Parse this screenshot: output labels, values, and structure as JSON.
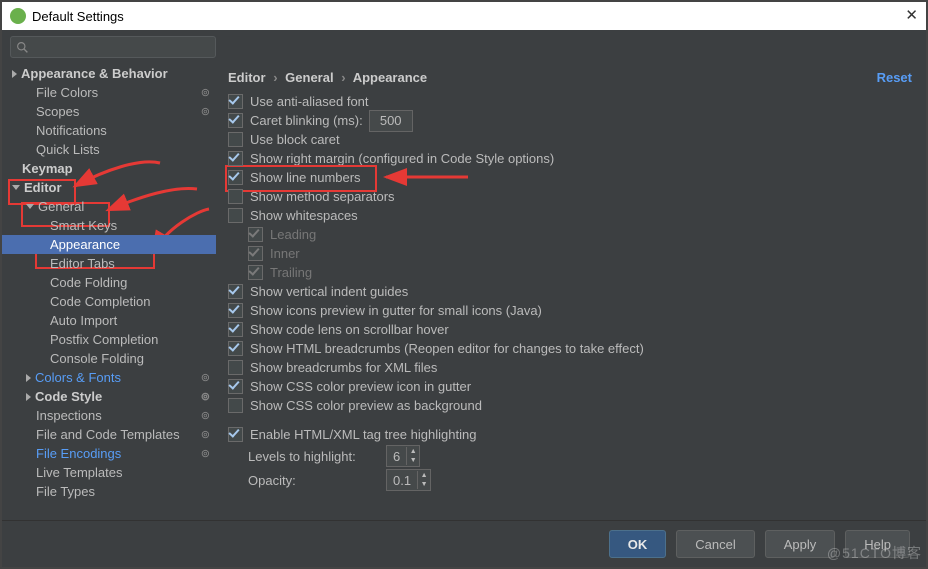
{
  "window": {
    "title": "Default Settings"
  },
  "sidebar": {
    "items": [
      {
        "label": "Appearance & Behavior",
        "indent": 10,
        "bold": true,
        "tri": "right"
      },
      {
        "label": "File Colors",
        "indent": 34,
        "gear": true
      },
      {
        "label": "Scopes",
        "indent": 34,
        "gear": true
      },
      {
        "label": "Notifications",
        "indent": 34
      },
      {
        "label": "Quick Lists",
        "indent": 34
      },
      {
        "label": "Keymap",
        "indent": 20,
        "bold": true
      },
      {
        "label": "Editor",
        "indent": 10,
        "bold": true,
        "tri": "down"
      },
      {
        "label": "General",
        "indent": 24,
        "tri": "down"
      },
      {
        "label": "Smart Keys",
        "indent": 48
      },
      {
        "label": "Appearance",
        "indent": 48,
        "sel": true
      },
      {
        "label": "Editor Tabs",
        "indent": 48
      },
      {
        "label": "Code Folding",
        "indent": 48
      },
      {
        "label": "Code Completion",
        "indent": 48
      },
      {
        "label": "Auto Import",
        "indent": 48
      },
      {
        "label": "Postfix Completion",
        "indent": 48
      },
      {
        "label": "Console Folding",
        "indent": 48
      },
      {
        "label": "Colors & Fonts",
        "indent": 24,
        "tri": "right",
        "link": true,
        "gear": true
      },
      {
        "label": "Code Style",
        "indent": 24,
        "bold": true,
        "tri": "right",
        "gear": true
      },
      {
        "label": "Inspections",
        "indent": 34,
        "gear": true
      },
      {
        "label": "File and Code Templates",
        "indent": 34,
        "gear": true
      },
      {
        "label": "File Encodings",
        "indent": 34,
        "link": true,
        "gear": true
      },
      {
        "label": "Live Templates",
        "indent": 34
      },
      {
        "label": "File Types",
        "indent": 34
      }
    ]
  },
  "breadcrumb": {
    "a": "Editor",
    "b": "General",
    "c": "Appearance",
    "reset": "Reset"
  },
  "options": [
    {
      "checked": true,
      "label": "Use anti-aliased font",
      "pad": 0
    },
    {
      "checked": true,
      "label": "Caret blinking (ms):",
      "pad": 0,
      "num": "500"
    },
    {
      "checked": false,
      "label": "Use block caret",
      "pad": 0
    },
    {
      "checked": true,
      "label": "Show right margin (configured in Code Style options)",
      "pad": 0
    },
    {
      "checked": true,
      "label": "Show line numbers",
      "pad": 0,
      "hl": true
    },
    {
      "checked": false,
      "label": "Show method separators",
      "pad": 0
    },
    {
      "checked": false,
      "label": "Show whitespaces",
      "pad": 0
    },
    {
      "checked": true,
      "label": "Leading",
      "pad": 20,
      "dis": true
    },
    {
      "checked": true,
      "label": "Inner",
      "pad": 20,
      "dis": true
    },
    {
      "checked": true,
      "label": "Trailing",
      "pad": 20,
      "dis": true
    },
    {
      "checked": true,
      "label": "Show vertical indent guides",
      "pad": 0
    },
    {
      "checked": true,
      "label": "Show icons preview in gutter for small icons (Java)",
      "pad": 0
    },
    {
      "checked": true,
      "label": "Show code lens on scrollbar hover",
      "pad": 0
    },
    {
      "checked": true,
      "label": "Show HTML breadcrumbs (Reopen editor for changes to take effect)",
      "pad": 0
    },
    {
      "checked": false,
      "label": "Show breadcrumbs for XML files",
      "pad": 0
    },
    {
      "checked": true,
      "label": "Show CSS color preview icon in gutter",
      "pad": 0
    },
    {
      "checked": false,
      "label": "Show CSS color preview as background",
      "pad": 0
    }
  ],
  "enable": {
    "checked": true,
    "label": "Enable HTML/XML tag tree highlighting"
  },
  "fields": {
    "levels_label": "Levels to highlight:",
    "levels_val": "6",
    "opacity_label": "Opacity:",
    "opacity_val": "0.1"
  },
  "footer": {
    "ok": "OK",
    "cancel": "Cancel",
    "apply": "Apply",
    "help": "Help"
  },
  "watermark": "@51CTO博客"
}
